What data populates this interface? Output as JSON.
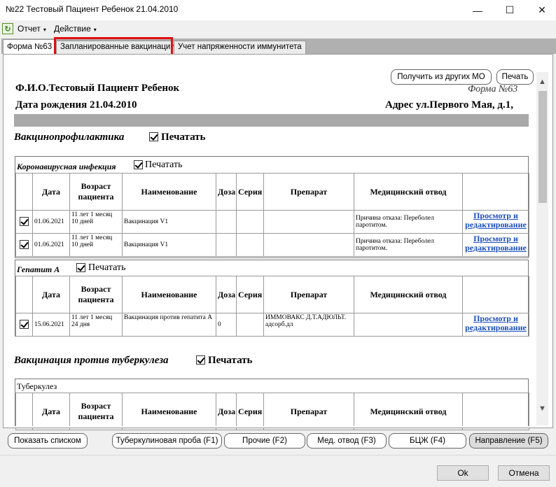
{
  "window": {
    "title": "№22 Тестовый Пациент Ребенок 21.04.2010",
    "minimize": "—",
    "maximize": "☐",
    "close": "✕"
  },
  "menu": {
    "items": [
      {
        "label": "Отчет"
      },
      {
        "label": "Действие"
      }
    ],
    "caret": "▾",
    "refresh_glyph": "↻"
  },
  "tabs": [
    {
      "label": "Форма №63"
    },
    {
      "label": "Запланированные вакцинации"
    },
    {
      "label": "Учет напряженности иммунитета"
    }
  ],
  "doc": {
    "get_from_mo": "Получить из других МО",
    "print": "Печать",
    "patient_name": "Ф.И.О.Тестовый Пациент Ребенок",
    "forma": "Форма №63",
    "dob": "Дата рождения 21.04.2010",
    "address": "Адрес ул.Первого Мая, д.1,",
    "print_label": "Печатать"
  },
  "sections": [
    {
      "title": "Вакцинопрофилактика"
    },
    {
      "title": "Вакцинация против туберкулеза"
    }
  ],
  "table_headers": [
    "Дата",
    "Возраст пациента",
    "Наименование",
    "Доза",
    "Серия",
    "Препарат",
    "Медицинский отвод"
  ],
  "link_text": "Просмотр и редактирование",
  "groups": {
    "covid": {
      "title": "Коронавирусная инфекция",
      "rows": [
        {
          "date": "01.06.2021",
          "age": "11 лет 1 месяц 10 дней",
          "name": "Вакцинация V1",
          "dose": "",
          "series": "",
          "drug": "",
          "exemption": "Причина отказа: Переболел паротитом."
        },
        {
          "date": "01.06.2021",
          "age": "11 лет 1 месяц 10 дней",
          "name": "Вакцинация V1",
          "dose": "",
          "series": "",
          "drug": "",
          "exemption": "Причина отказа: Переболел паротитом."
        }
      ]
    },
    "hepa": {
      "title": "Гепатит А",
      "rows": [
        {
          "date": "15.06.2021",
          "age": "11 лет 1 месяц 24 дня",
          "name": "Вакцинация против гепатита А",
          "dose": "0",
          "series": "",
          "drug": "ИММОВАКС Д.Т.АДЮЛЬТ. адсорб.дл",
          "exemption": ""
        }
      ]
    },
    "tb": {
      "title": "Туберкулез"
    }
  },
  "bottom_buttons": {
    "list": "Показать списком",
    "tuberculin": "Туберкулиновая проба (F1)",
    "other": "Прочие (F2)",
    "med_exemption": "Мед. отвод (F3)",
    "bcg": "БЦЖ (F4)",
    "referral": "Направление (F5)"
  },
  "footer": {
    "ok": "Ok",
    "cancel": "Отмена"
  },
  "scroll": {
    "up": "▲",
    "down": "▼"
  }
}
